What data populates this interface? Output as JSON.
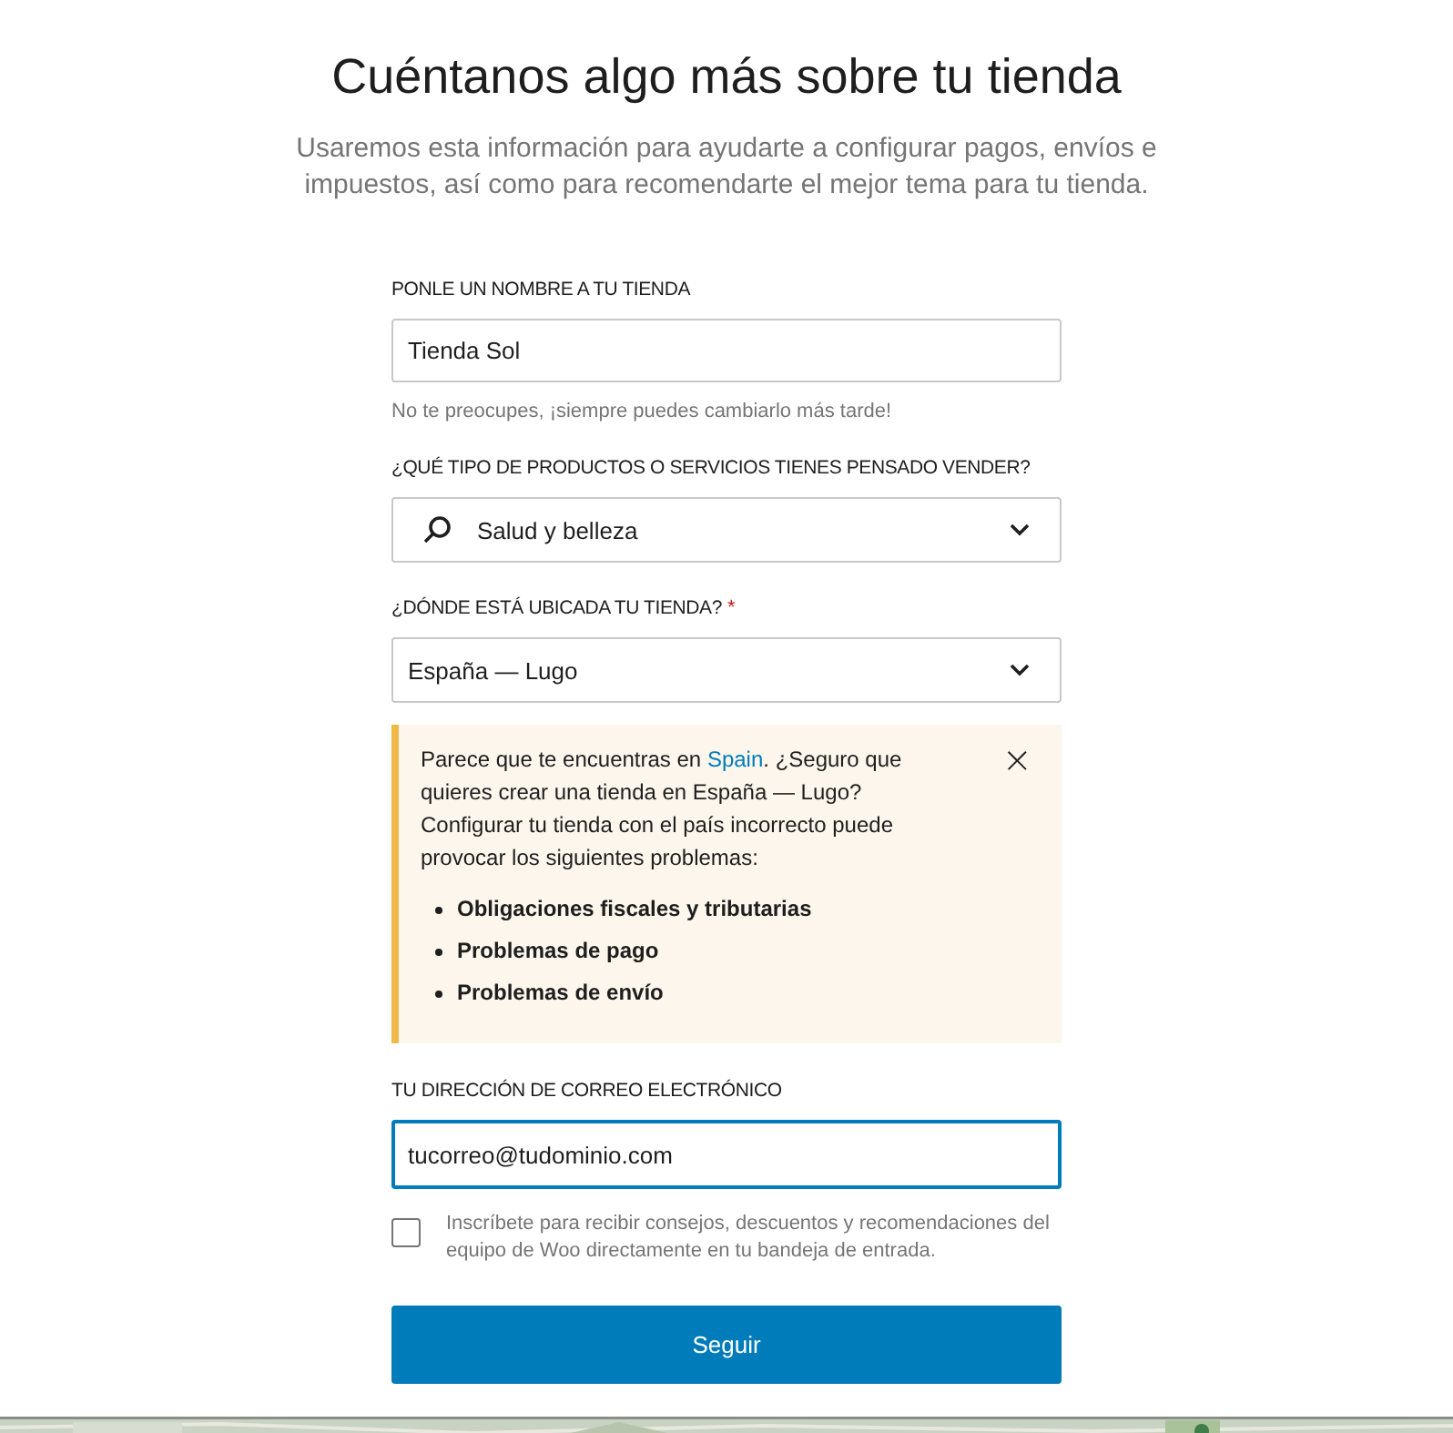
{
  "heading": "Cuéntanos algo más sobre tu tienda",
  "subheading": "Usaremos esta información para ayudarte a configurar pagos, envíos e impuestos, así como para recomendarte el mejor tema para tu tienda.",
  "store_name": {
    "label": "PONLE UN NOMBRE A TU TIENDA",
    "value": "Tienda Sol",
    "help": "No te preocupes, ¡siempre puedes cambiarlo más tarde!"
  },
  "industry": {
    "label": "¿QUÉ TIPO DE PRODUCTOS O SERVICIOS TIENES PENSADO VENDER?",
    "value": "Salud y belleza"
  },
  "location": {
    "label": "¿DÓNDE ESTÁ UBICADA TU TIENDA?",
    "required_mark": "*",
    "value": "España — Lugo"
  },
  "notice": {
    "text_before": "Parece que te encuentras en ",
    "link": "Spain",
    "text_after": ". ¿Seguro que quieres crear una tienda en España — Lugo? Configurar tu tienda con el país incorrecto puede provocar los siguientes problemas:",
    "items": [
      "Obligaciones fiscales y tributarias",
      "Problemas de pago",
      "Problemas de envío"
    ],
    "close": "×"
  },
  "email": {
    "label": "TU DIRECCIÓN DE CORREO ELECTRÓNICO",
    "value": "tucorreo@tudominio.com",
    "focused": true
  },
  "opt_in": {
    "label": "Inscríbete para recibir consejos, descuentos y recomendaciones del equipo de Woo directamente en tu bandeja de entrada.",
    "checked": false
  },
  "submit": "Seguir"
}
